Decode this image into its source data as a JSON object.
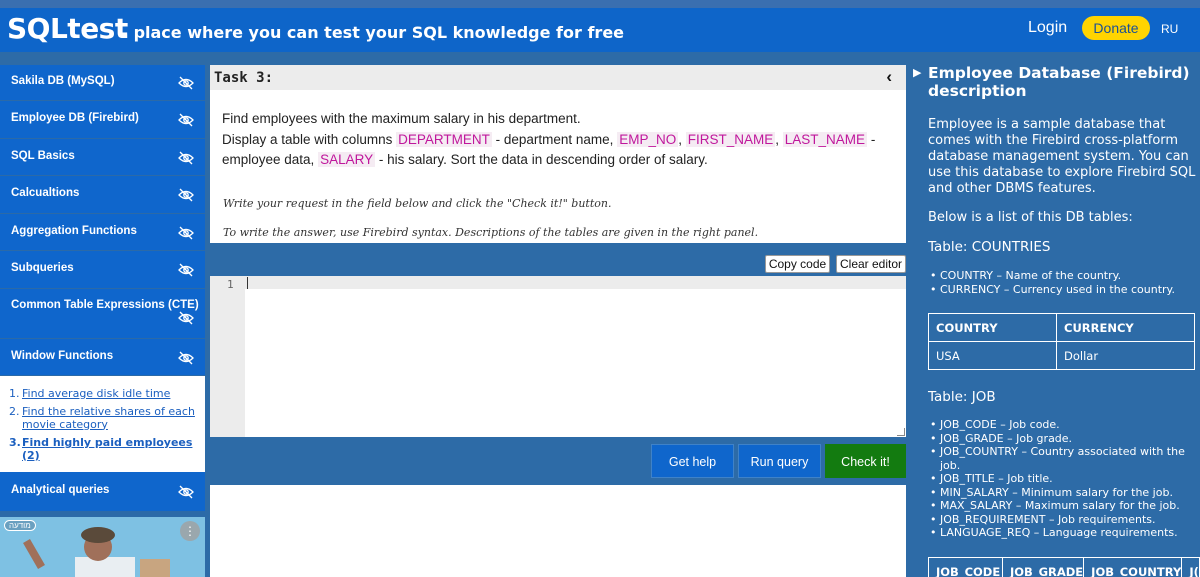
{
  "header": {
    "brand": "SQLtest",
    "tagline": "– place where you can test your SQL knowledge for free",
    "login": "Login",
    "donate": "Donate",
    "lang": "RU"
  },
  "sidebar": {
    "items": [
      {
        "label": "Sakila DB (MySQL)"
      },
      {
        "label": "Employee DB (Firebird)"
      },
      {
        "label": "SQL Basics"
      },
      {
        "label": "Calcualtions"
      },
      {
        "label": "Aggregation Functions"
      },
      {
        "label": "Subqueries"
      },
      {
        "label": "Common Table Expressions (CTE)"
      },
      {
        "label": "Window Functions"
      },
      {
        "label": "Analytical queries"
      }
    ],
    "subitems": [
      {
        "num": "1.",
        "label": "Find average disk idle time"
      },
      {
        "num": "2.",
        "label": "Find the relative shares of each movie category"
      },
      {
        "num": "3.",
        "label": "Find highly paid employees (2)"
      }
    ],
    "ad_tag": "מודעה",
    "ad_menu": "⋮"
  },
  "task": {
    "title": "Task 3:",
    "line1": "Find employees with the maximum salary in his department.",
    "line2a": "Display a table with columns",
    "kw_department": "DEPARTMENT",
    "line2b": "- department name,",
    "kw_emp_no": "EMP_NO",
    "kw_first_name": "FIRST_NAME",
    "kw_last_name": "LAST_NAME",
    "line2c": "-",
    "line3a": "employee data,",
    "kw_salary": "SALARY",
    "line3b": "- his salary. Sort the data in descending order of salary.",
    "hint1": "Write your request in the field below and click the \"Check it!\" button.",
    "hint2": "To write the answer, use Firebird syntax. Descriptions of the tables are given in the right panel."
  },
  "editor": {
    "copy_code": "Copy code",
    "clear_editor": "Clear editor",
    "line_number": "1"
  },
  "actions": {
    "get_help": "Get help",
    "run_query": "Run query",
    "check_it": "Check it!"
  },
  "right_panel": {
    "title": "Employee Database (Firebird) description",
    "desc": "Employee is a sample database that comes with the Firebird cross-platform database management system. You can use this database to explore Firebird SQL and other DBMS features.",
    "list_intro": "Below is a list of this DB tables:",
    "countries": {
      "heading": "Table: COUNTRIES",
      "fields": [
        "COUNTRY – Name of the country.",
        "CURRENCY – Currency used in the country."
      ],
      "columns": [
        "COUNTRY",
        "CURRENCY"
      ],
      "rows": [
        [
          "USA",
          "Dollar"
        ]
      ]
    },
    "job": {
      "heading": "Table: JOB",
      "fields": [
        "JOB_CODE – Job code.",
        "JOB_GRADE – Job grade.",
        "JOB_COUNTRY – Country associated with the job.",
        "JOB_TITLE – Job title.",
        "MIN_SALARY – Minimum salary for the job.",
        "MAX_SALARY – Maximum salary for the job.",
        "JOB_REQUIREMENT – Job requirements.",
        "LANGUAGE_REQ – Language requirements."
      ],
      "columns": [
        "JOB_CODE",
        "JOB_GRADE",
        "JOB_COUNTRY",
        "J("
      ]
    }
  },
  "colors": {
    "header_bg": "#0e65c9",
    "sidebar_item_bg": "#0f66cc",
    "page_bg": "#2d6ba7",
    "donate_bg": "#ffd400",
    "keyword": "#c0179c",
    "check_btn_bg": "#137b10",
    "action_btn_bg": "#0f66cc"
  }
}
